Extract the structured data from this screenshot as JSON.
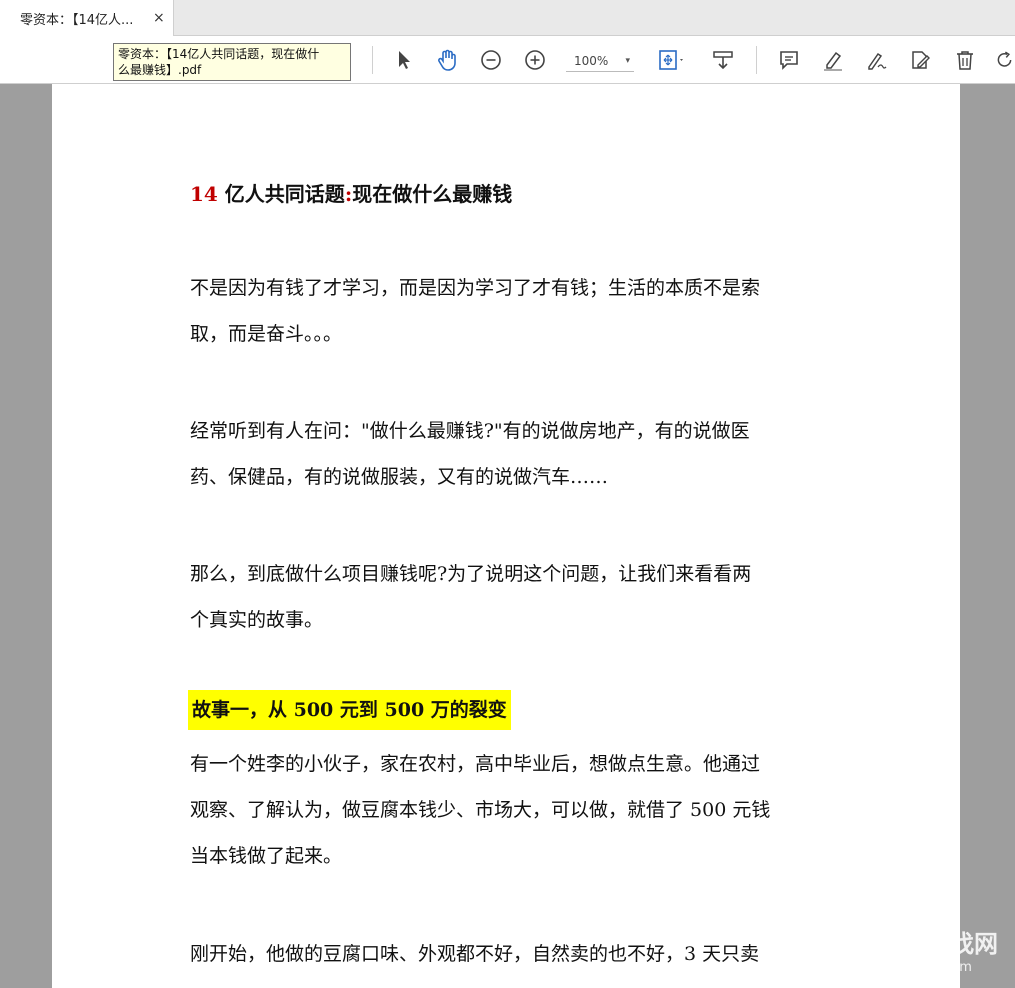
{
  "tab": {
    "title": "零资本：【14亿人...",
    "close": "×"
  },
  "toolbar": {
    "zoom": "100%",
    "zoom_caret": "▾",
    "icons": [
      "cursor-icon",
      "hand-icon",
      "zoom-out-icon",
      "zoom-in-icon",
      "fit-page-icon",
      "scroll-mode-icon",
      "comment-icon",
      "highlight-icon",
      "sign-icon",
      "edit-icon",
      "delete-icon",
      "rotate-icon"
    ]
  },
  "tooltip": {
    "line1": "零资本：【14亿人共同话题，现在做什",
    "line2": "么最赚钱】.pdf"
  },
  "document": {
    "heading_num": "14",
    "heading_a": " 亿人共同话题",
    "heading_colon": ":",
    "heading_b": "现在做什么最赚钱",
    "paragraphs": [
      [
        "不是因为有钱了才学习，而是因为学习了才有钱；生活的本质不是索",
        "取，而是奋斗。。。"
      ],
      [
        "经常听到有人在问：\"做什么最赚钱?\"有的说做房地产，有的说做医",
        "药、保健品，有的说做服装，又有的说做汽车……"
      ],
      [
        "那么，到底做什么项目赚钱呢?为了说明这个问题，让我们来看看两",
        "个真实的故事。"
      ]
    ],
    "story_title": "故事一，从 500 元到 500 万的裂变",
    "story_paragraph": [
      "有一个姓李的小伙子，家在农村，高中毕业后，想做点生意。他通过",
      "观察、了解认为，做豆腐本钱少、市场大，可以做，就借了 500 元钱",
      "当本钱做了起来。"
    ],
    "last_paragraph": "刚开始，他做的豆腐口味、外观都不好，自然卖的也不好，3 天只卖"
  },
  "watermark": {
    "title": "我帮找网",
    "url": "wobangzhao.com"
  },
  "colors": {
    "accent_blue": "#2b6cc4",
    "highlight": "#ffff00",
    "heading_red": "#c00000"
  }
}
